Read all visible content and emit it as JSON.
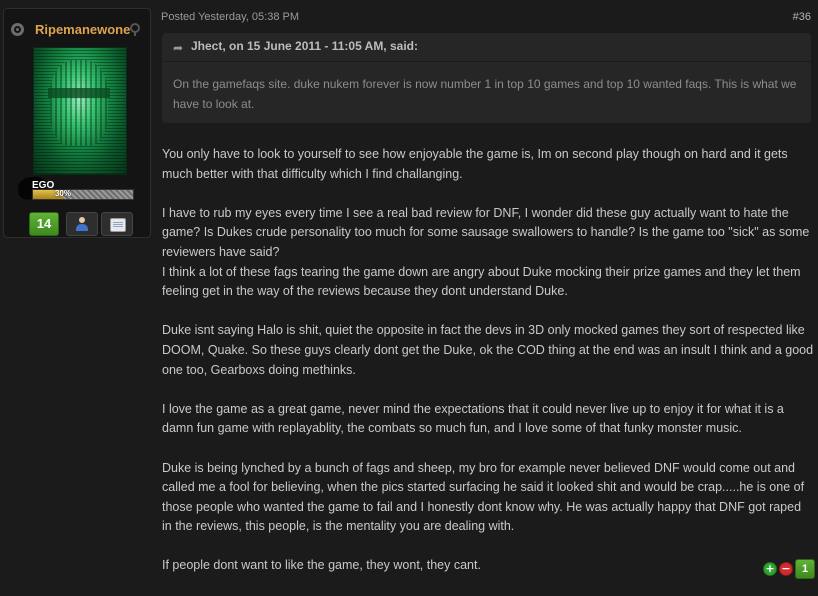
{
  "author": {
    "username": "Ripemanewone",
    "ego_label": "EGO",
    "ego_percent": "30%",
    "ego_fraction": 0.3,
    "reputation": "14",
    "icons": {
      "status": "radiation-icon",
      "online_status": "offline-icon",
      "profile": "profile-icon",
      "message": "message-icon"
    }
  },
  "post": {
    "meta": "Posted Yesterday, 05:38 PM",
    "number": "#36",
    "quote": {
      "author": "Jhect, on 15 June 2011 - 11:05 AM, said:",
      "text": "On the gamefaqs site. duke nukem forever is now number 1 in top 10 games and top 10 wanted faqs. This is what we have to look at."
    },
    "paragraphs": [
      "You only have to look to yourself to see how enjoyable the game is, Im on second play though on hard and it gets much better with that difficulty which I find challanging.",
      "I have to rub my eyes every time I see a real bad review for DNF, I wonder did these guy actually want to hate the game? Is Dukes crude personality too much for some sausage swallowers to handle? Is the game too \"sick\" as some reviewers have said?",
      "I think a lot of these fags tearing the game down are angry about Duke mocking their prize games and they let them feeling get in the way of the reviews because they dont understand Duke.",
      "Duke isnt saying Halo is shit, quiet the opposite in fact the devs in 3D only mocked games they sort of respected like DOOM, Quake. So these guys clearly dont get the Duke, ok the COD thing at the end was an insult I think and a good one too, Gearboxs doing methinks.",
      "I love the game as a great game, never mind the expectations that it could never live up to enjoy it for what it is a damn fun game with replayablity, the combats so much fun, and I love some of that funky monster music.",
      "Duke is being lynched by a bunch of fags and sheep, my bro for example never believed DNF would come out and called me a fool for believing, when the pics started surfacing he said it looked shit and would be crap.....he is one of those people who wanted the game to fail and I honestly dont know why. He was actually happy that DNF got raped in the reviews, this people, is the mentality you are dealing with.",
      "If people dont want to like the game, they wont, they cant."
    ],
    "rating": {
      "up_symbol": "+",
      "down_symbol": "−",
      "count": "1"
    }
  },
  "colors": {
    "background": "#1b1b1b",
    "username": "#e0a24c",
    "reputation_green": "#4d9e27",
    "vote_up": "#2fa52f",
    "vote_down": "#d22b2b"
  }
}
